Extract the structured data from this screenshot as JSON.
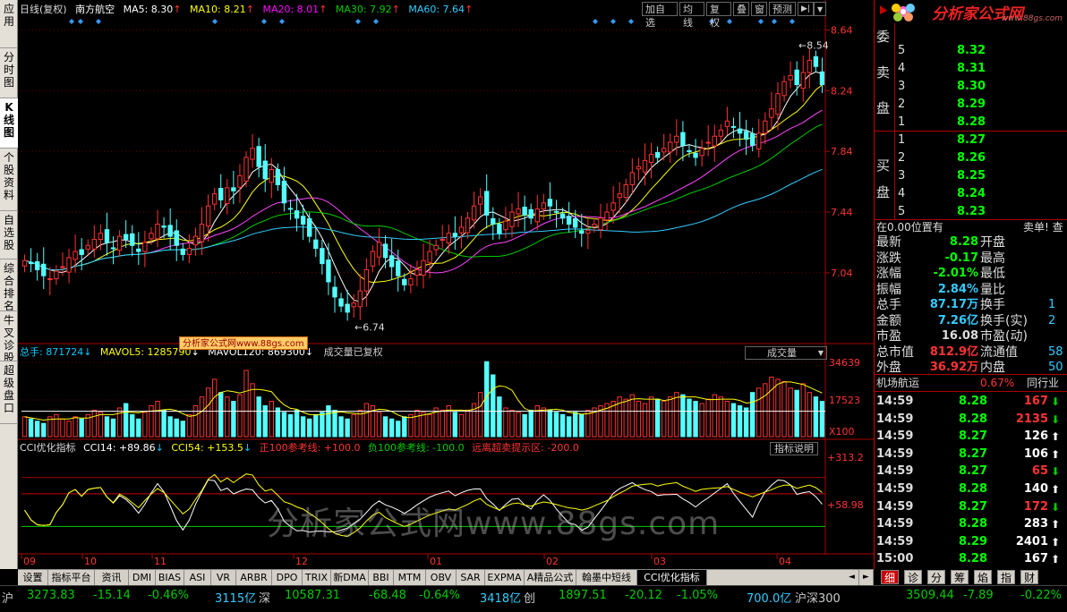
{
  "left_tabs": [
    {
      "label": "应用"
    },
    {
      "label": "分时图"
    },
    {
      "label": "K线图",
      "active": true
    },
    {
      "label": "个股资料"
    },
    {
      "label": "自选股"
    },
    {
      "label": "综合排名"
    },
    {
      "label": "牛叉诊股"
    },
    {
      "label": "超级盘口"
    }
  ],
  "header": {
    "period": "日线(复权)",
    "stock_name": "南方航空",
    "ma5": "MA5: 8.30",
    "ma10": "MA10: 8.21",
    "ma20": "MA20: 8.01",
    "ma30": "MA30: 7.92",
    "ma60": "MA60: 7.64",
    "up_arrow": "↑",
    "buttons": [
      "加自选",
      "均线",
      "复权",
      "叠",
      "窗",
      "预测"
    ],
    "menu_icon": "play-icon",
    "dropdown_icon": "chevron-down-icon"
  },
  "price_axis": {
    "labels": [
      "8.64",
      "8.24",
      "7.84",
      "7.44",
      "7.04"
    ],
    "high_note": "8.54",
    "low_note": "6.74"
  },
  "volume_header": {
    "total": "总手: 871724",
    "mavol5": "MAVOL5: 1285790",
    "mavol120": "MAVOL120: 869300",
    "note": "成交量已复权",
    "selector": "成交量",
    "axis": [
      "34639",
      "17523",
      "X100"
    ],
    "watermark_badge": "分析家公式网www.88gs.com"
  },
  "cci_header": {
    "name": "CCI优化指标",
    "cci14": "CCI14: +89.86",
    "cci54": "CCI54: +153.5",
    "ref_pos": "正100参考线: +100.0",
    "ref_neg": "负100参考线: -100.0",
    "extreme": "远离超卖提示区: -200.0",
    "explain_btn": "指标说明",
    "axis": [
      "+313.2",
      "+58.98"
    ],
    "down_arrow": "↓"
  },
  "date_axis": [
    "09",
    "10",
    "11",
    "12",
    "01",
    "02",
    "03",
    "04"
  ],
  "watermark": "分析家公式网www.88gs.com",
  "logo": {
    "text": "分析家公式网",
    "url": "www.88gs.com"
  },
  "order_book": {
    "sell_label": [
      "委",
      "卖",
      "盘"
    ],
    "buy_label": [
      "买",
      "盘"
    ],
    "sell": [
      {
        "level": "5",
        "price": "8.32"
      },
      {
        "level": "4",
        "price": "8.31"
      },
      {
        "level": "3",
        "price": "8.30"
      },
      {
        "level": "2",
        "price": "8.29"
      },
      {
        "level": "1",
        "price": "8.28"
      }
    ],
    "buy": [
      {
        "level": "1",
        "price": "8.27"
      },
      {
        "level": "2",
        "price": "8.26"
      },
      {
        "level": "3",
        "price": "8.25"
      },
      {
        "level": "4",
        "price": "8.24"
      },
      {
        "level": "5",
        "price": "8.23"
      }
    ]
  },
  "position_line": {
    "left": "在0.00位置有",
    "right": "卖单! 查"
  },
  "quote_stats": [
    {
      "label": "最新",
      "value": "8.28",
      "label2": "开盘",
      "value2": ""
    },
    {
      "label": "涨跌",
      "value": "-0.17",
      "label2": "最高",
      "value2": ""
    },
    {
      "label": "涨幅",
      "value": "-2.01%",
      "label2": "最低",
      "value2": ""
    },
    {
      "label": "振幅",
      "value": "2.84%",
      "label2": "量比",
      "value2": ""
    },
    {
      "label": "总手",
      "value": "87.17万",
      "label2": "换手",
      "value2": "1"
    },
    {
      "label": "金额",
      "value": "7.26亿",
      "label2": "换手(实)",
      "value2": "2"
    },
    {
      "label": "市盈",
      "value": "16.08",
      "label2": "市盈(动)",
      "value2": ""
    },
    {
      "label": "总市值",
      "value": "812.9亿",
      "label2": "流通值",
      "value2": "58"
    },
    {
      "label": "外盘",
      "value": "36.92万",
      "label2": "内盘",
      "value2": "50"
    }
  ],
  "industry": {
    "name": "机场航运",
    "change": "0.67%",
    "same_industry": "同行业"
  },
  "ticks": [
    {
      "time": "14:59",
      "price": "8.28",
      "vol": "167",
      "dir": "down"
    },
    {
      "time": "14:59",
      "price": "8.28",
      "vol": "2135",
      "dir": "down"
    },
    {
      "time": "14:59",
      "price": "8.27",
      "vol": "126",
      "dir": "up"
    },
    {
      "time": "14:59",
      "price": "8.27",
      "vol": "106",
      "dir": "up"
    },
    {
      "time": "14:59",
      "price": "8.27",
      "vol": "65",
      "dir": "down"
    },
    {
      "time": "14:59",
      "price": "8.28",
      "vol": "140",
      "dir": "up"
    },
    {
      "time": "14:59",
      "price": "8.27",
      "vol": "172",
      "dir": "down"
    },
    {
      "time": "14:59",
      "price": "8.28",
      "vol": "283",
      "dir": "up"
    },
    {
      "time": "14:59",
      "price": "8.29",
      "vol": "2401",
      "dir": "up"
    },
    {
      "time": "15:00",
      "price": "8.28",
      "vol": "167",
      "dir": "up"
    }
  ],
  "bottom_tabs": [
    "设置",
    "指标平台",
    "资讯",
    "DMI",
    "BIAS",
    "ASI",
    "VR",
    "ARBR",
    "DPO",
    "TRIX",
    "新DMA",
    "BBI",
    "MTM",
    "OBV",
    "SAR",
    "EXPMA",
    "A精品公式",
    "翰墨中短线",
    "CCI优化指标"
  ],
  "right_bottom_tabs": [
    "细",
    "诊",
    "分",
    "筹",
    "焰",
    "指",
    "财"
  ],
  "status_bar": {
    "sh_label": "沪",
    "sh_index": "3273.83",
    "sh_change": "-15.14",
    "sh_pct": "-0.46%",
    "sh_amount": "3115亿",
    "sz_label": "深",
    "sz_index": "10587.31",
    "sz_change": "-68.48",
    "sz_pct": "-0.64%",
    "sz_amount": "3418亿",
    "cy_label": "创",
    "cy_index": "1897.51",
    "cy_change": "-20.12",
    "cy_pct": "-1.05%",
    "cy_amount": "700.0亿",
    "hs_label": "沪深300",
    "hs_index": "3509.44",
    "hs_change": "-7.89",
    "hs_pct": "-0.22%"
  },
  "chart_data": {
    "type": "candlestick",
    "title": "南方航空 日线(复权)",
    "price_range": [
      6.62,
      8.72
    ],
    "high": 8.54,
    "low": 6.74,
    "x_labels": [
      "09",
      "10",
      "11",
      "12",
      "01",
      "02",
      "03",
      "04"
    ],
    "closes": [
      7.12,
      7.1,
      7.06,
      7.02,
      7.0,
      7.05,
      7.08,
      7.14,
      7.18,
      7.16,
      7.22,
      7.26,
      7.3,
      7.24,
      7.2,
      7.28,
      7.26,
      7.22,
      7.18,
      7.24,
      7.3,
      7.36,
      7.34,
      7.28,
      7.22,
      7.16,
      7.2,
      7.28,
      7.36,
      7.48,
      7.56,
      7.52,
      7.6,
      7.58,
      7.68,
      7.8,
      7.86,
      7.74,
      7.66,
      7.72,
      7.62,
      7.5,
      7.46,
      7.4,
      7.36,
      7.28,
      7.2,
      7.1,
      6.98,
      6.88,
      6.82,
      6.78,
      6.84,
      6.92,
      7.06,
      7.18,
      7.24,
      7.14,
      7.08,
      7.02,
      6.96,
      7.0,
      7.06,
      7.12,
      7.18,
      7.22,
      7.26,
      7.3,
      7.28,
      7.34,
      7.4,
      7.48,
      7.54,
      7.42,
      7.36,
      7.3,
      7.38,
      7.44,
      7.46,
      7.42,
      7.4,
      7.46,
      7.5,
      7.48,
      7.44,
      7.4,
      7.36,
      7.34,
      7.3,
      7.32,
      7.36,
      7.4,
      7.44,
      7.5,
      7.56,
      7.62,
      7.7,
      7.74,
      7.78,
      7.82,
      7.8,
      7.86,
      7.9,
      7.94,
      7.88,
      7.84,
      7.8,
      7.86,
      7.9,
      7.94,
      7.98,
      8.04,
      8.0,
      7.96,
      7.92,
      7.88,
      7.96,
      8.04,
      8.12,
      8.22,
      8.3,
      8.34,
      8.28,
      8.36,
      8.44,
      8.4,
      8.28
    ],
    "volumes": [
      9,
      8,
      7,
      6,
      9,
      10,
      8,
      7,
      9,
      8,
      10,
      12,
      11,
      9,
      8,
      13,
      15,
      10,
      8,
      11,
      14,
      16,
      12,
      9,
      8,
      7,
      10,
      14,
      18,
      22,
      26,
      20,
      18,
      16,
      19,
      30,
      24,
      18,
      14,
      16,
      13,
      11,
      10,
      12,
      9,
      8,
      10,
      11,
      14,
      12,
      9,
      8,
      10,
      12,
      15,
      14,
      11,
      9,
      8,
      7,
      9,
      10,
      12,
      11,
      10,
      13,
      12,
      14,
      11,
      10,
      12,
      15,
      20,
      34,
      28,
      18,
      13,
      12,
      11,
      10,
      12,
      14,
      13,
      12,
      11,
      10,
      9,
      11,
      10,
      12,
      13,
      14,
      15,
      16,
      18,
      17,
      19,
      16,
      15,
      18,
      17,
      16,
      18,
      20,
      19,
      17,
      16,
      15,
      17,
      19,
      18,
      16,
      15,
      14,
      13,
      20,
      22,
      24,
      27,
      26,
      25,
      22,
      21,
      24,
      20,
      18,
      16
    ],
    "volume_axis": [
      0,
      34639
    ],
    "cci_axis": [
      "+313.2",
      "+58.98"
    ]
  }
}
